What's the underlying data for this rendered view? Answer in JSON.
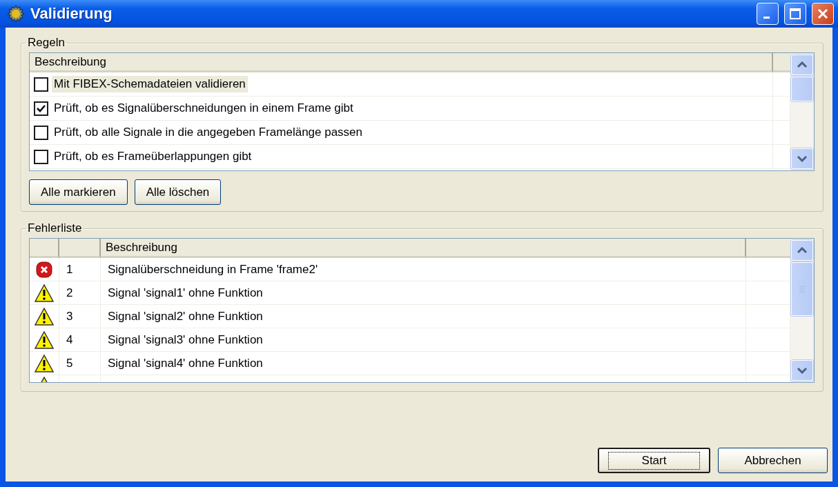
{
  "window": {
    "title": "Validierung"
  },
  "rules": {
    "legend": "Regeln",
    "columns": [
      "Beschreibung"
    ],
    "rows": [
      {
        "label": "Mit FIBEX-Schemadateien validieren",
        "checked": false,
        "selected": true
      },
      {
        "label": "Prüft, ob es Signalüberschneidungen in einem Frame gibt",
        "checked": true,
        "selected": false
      },
      {
        "label": "Prüft, ob alle Signale in die angegeben Framelänge passen",
        "checked": false,
        "selected": false
      },
      {
        "label": "Prüft, ob es Frameüberlappungen gibt",
        "checked": false,
        "selected": false
      }
    ],
    "buttons": [
      "Alle markieren",
      "Alle löschen"
    ]
  },
  "errors": {
    "legend": "Fehlerliste",
    "columns": [
      "Beschreibung"
    ],
    "rows": [
      {
        "kind": "error",
        "number": "1",
        "description": "Signalüberschneidung in Frame 'frame2'"
      },
      {
        "kind": "warning",
        "number": "2",
        "description": "Signal 'signal1' ohne Funktion"
      },
      {
        "kind": "warning",
        "number": "3",
        "description": "Signal 'signal2' ohne Funktion"
      },
      {
        "kind": "warning",
        "number": "4",
        "description": "Signal 'signal3' ohne Funktion"
      },
      {
        "kind": "warning",
        "number": "5",
        "description": "Signal 'signal4' ohne Funktion"
      }
    ]
  },
  "buttons": [
    {
      "label": "Start",
      "focused": true
    },
    {
      "label": "Abbrechen",
      "focused": false
    }
  ]
}
